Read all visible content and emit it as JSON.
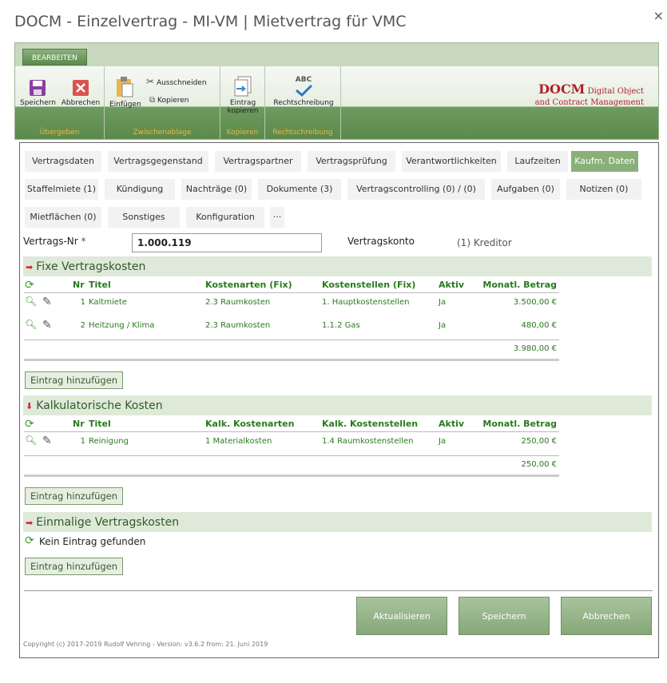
{
  "window": {
    "title": "DOCM - Einzelvertrag - MI-VM | Mietvertrag für VMC",
    "close": "×"
  },
  "ribbon": {
    "tab": "BEARBEITEN",
    "groups": [
      {
        "label": "Übergeben",
        "buttons": [
          "Speichern",
          "Abbrechen"
        ]
      },
      {
        "label": "Zwischenablage",
        "buttons": [
          "Einfügen",
          "Ausschneiden",
          "Kopieren"
        ]
      },
      {
        "label": "Kopieren",
        "buttons": [
          "Eintrag kopieren"
        ]
      },
      {
        "label": "Rechtschreibung",
        "buttons": [
          "Rechtschreibung"
        ]
      }
    ],
    "abc": "ABC",
    "brand_main": "DOCM",
    "brand_sub1": "Digital Object",
    "brand_sub2": "and Contract Management"
  },
  "tabs": [
    "Vertragsdaten",
    "Vertragsgegenstand",
    "Vertragspartner",
    "Vertragsprüfung",
    "Verantwortlichkeiten",
    "Laufzeiten",
    "Kaufm. Daten",
    "Staffelmiete (1)",
    "Kündigung",
    "Nachträge (0)",
    "Dokumente (3)",
    "Vertragscontrolling (0) / (0)",
    "Aufgaben (0)",
    "Notizen (0)",
    "Mietflächen (0)",
    "Sonstiges",
    "Konfiguration",
    "···"
  ],
  "header": {
    "nr_label": "Vertrags-Nr",
    "required": "*",
    "nr_value": "1.000.119",
    "konto_label": "Vertragskonto",
    "konto_value": "(1) Kreditor"
  },
  "fixe": {
    "title": "Fixe Vertragskosten",
    "cols": [
      "Nr",
      "Titel",
      "Kostenarten (Fix)",
      "Kostenstellen (Fix)",
      "Aktiv",
      "Monatl. Betrag"
    ],
    "rows": [
      [
        "1",
        "Kaltmiete",
        "2.3 Raumkosten",
        "1. Hauptkostenstellen",
        "Ja",
        "3.500,00 €"
      ],
      [
        "2",
        "Heitzung / Klima",
        "2.3 Raumkosten",
        "1.1.2 Gas",
        "Ja",
        "480,00 €"
      ]
    ],
    "total": "3.980,00 €",
    "add": "Eintrag hinzufügen"
  },
  "kalk": {
    "title": "Kalkulatorische Kosten",
    "cols": [
      "Nr",
      "Titel",
      "Kalk. Kostenarten",
      "Kalk. Kostenstellen",
      "Aktiv",
      "Monatl. Betrag"
    ],
    "rows": [
      [
        "1",
        "Reinigung",
        "1 Materialkosten",
        "1.4 Raumkostenstellen",
        "Ja",
        "250,00 €"
      ]
    ],
    "total": "250,00 €",
    "add": "Eintrag hinzufügen"
  },
  "einmalig": {
    "title": "Einmalige Vertragskosten",
    "empty": "Kein Eintrag gefunden",
    "add": "Eintrag hinzufügen"
  },
  "footer": {
    "refresh": "Aktualisieren",
    "save": "Speichern",
    "cancel": "Abbrechen",
    "copyright": "Copyright (c) 2017-2019 Rudolf Vehring - Version: v3.6.2 from: 21. Juni 2019"
  },
  "colors": {
    "accent": "#8ab07a",
    "green_text": "#2a7a1f",
    "brand_red": "#b2202a"
  }
}
